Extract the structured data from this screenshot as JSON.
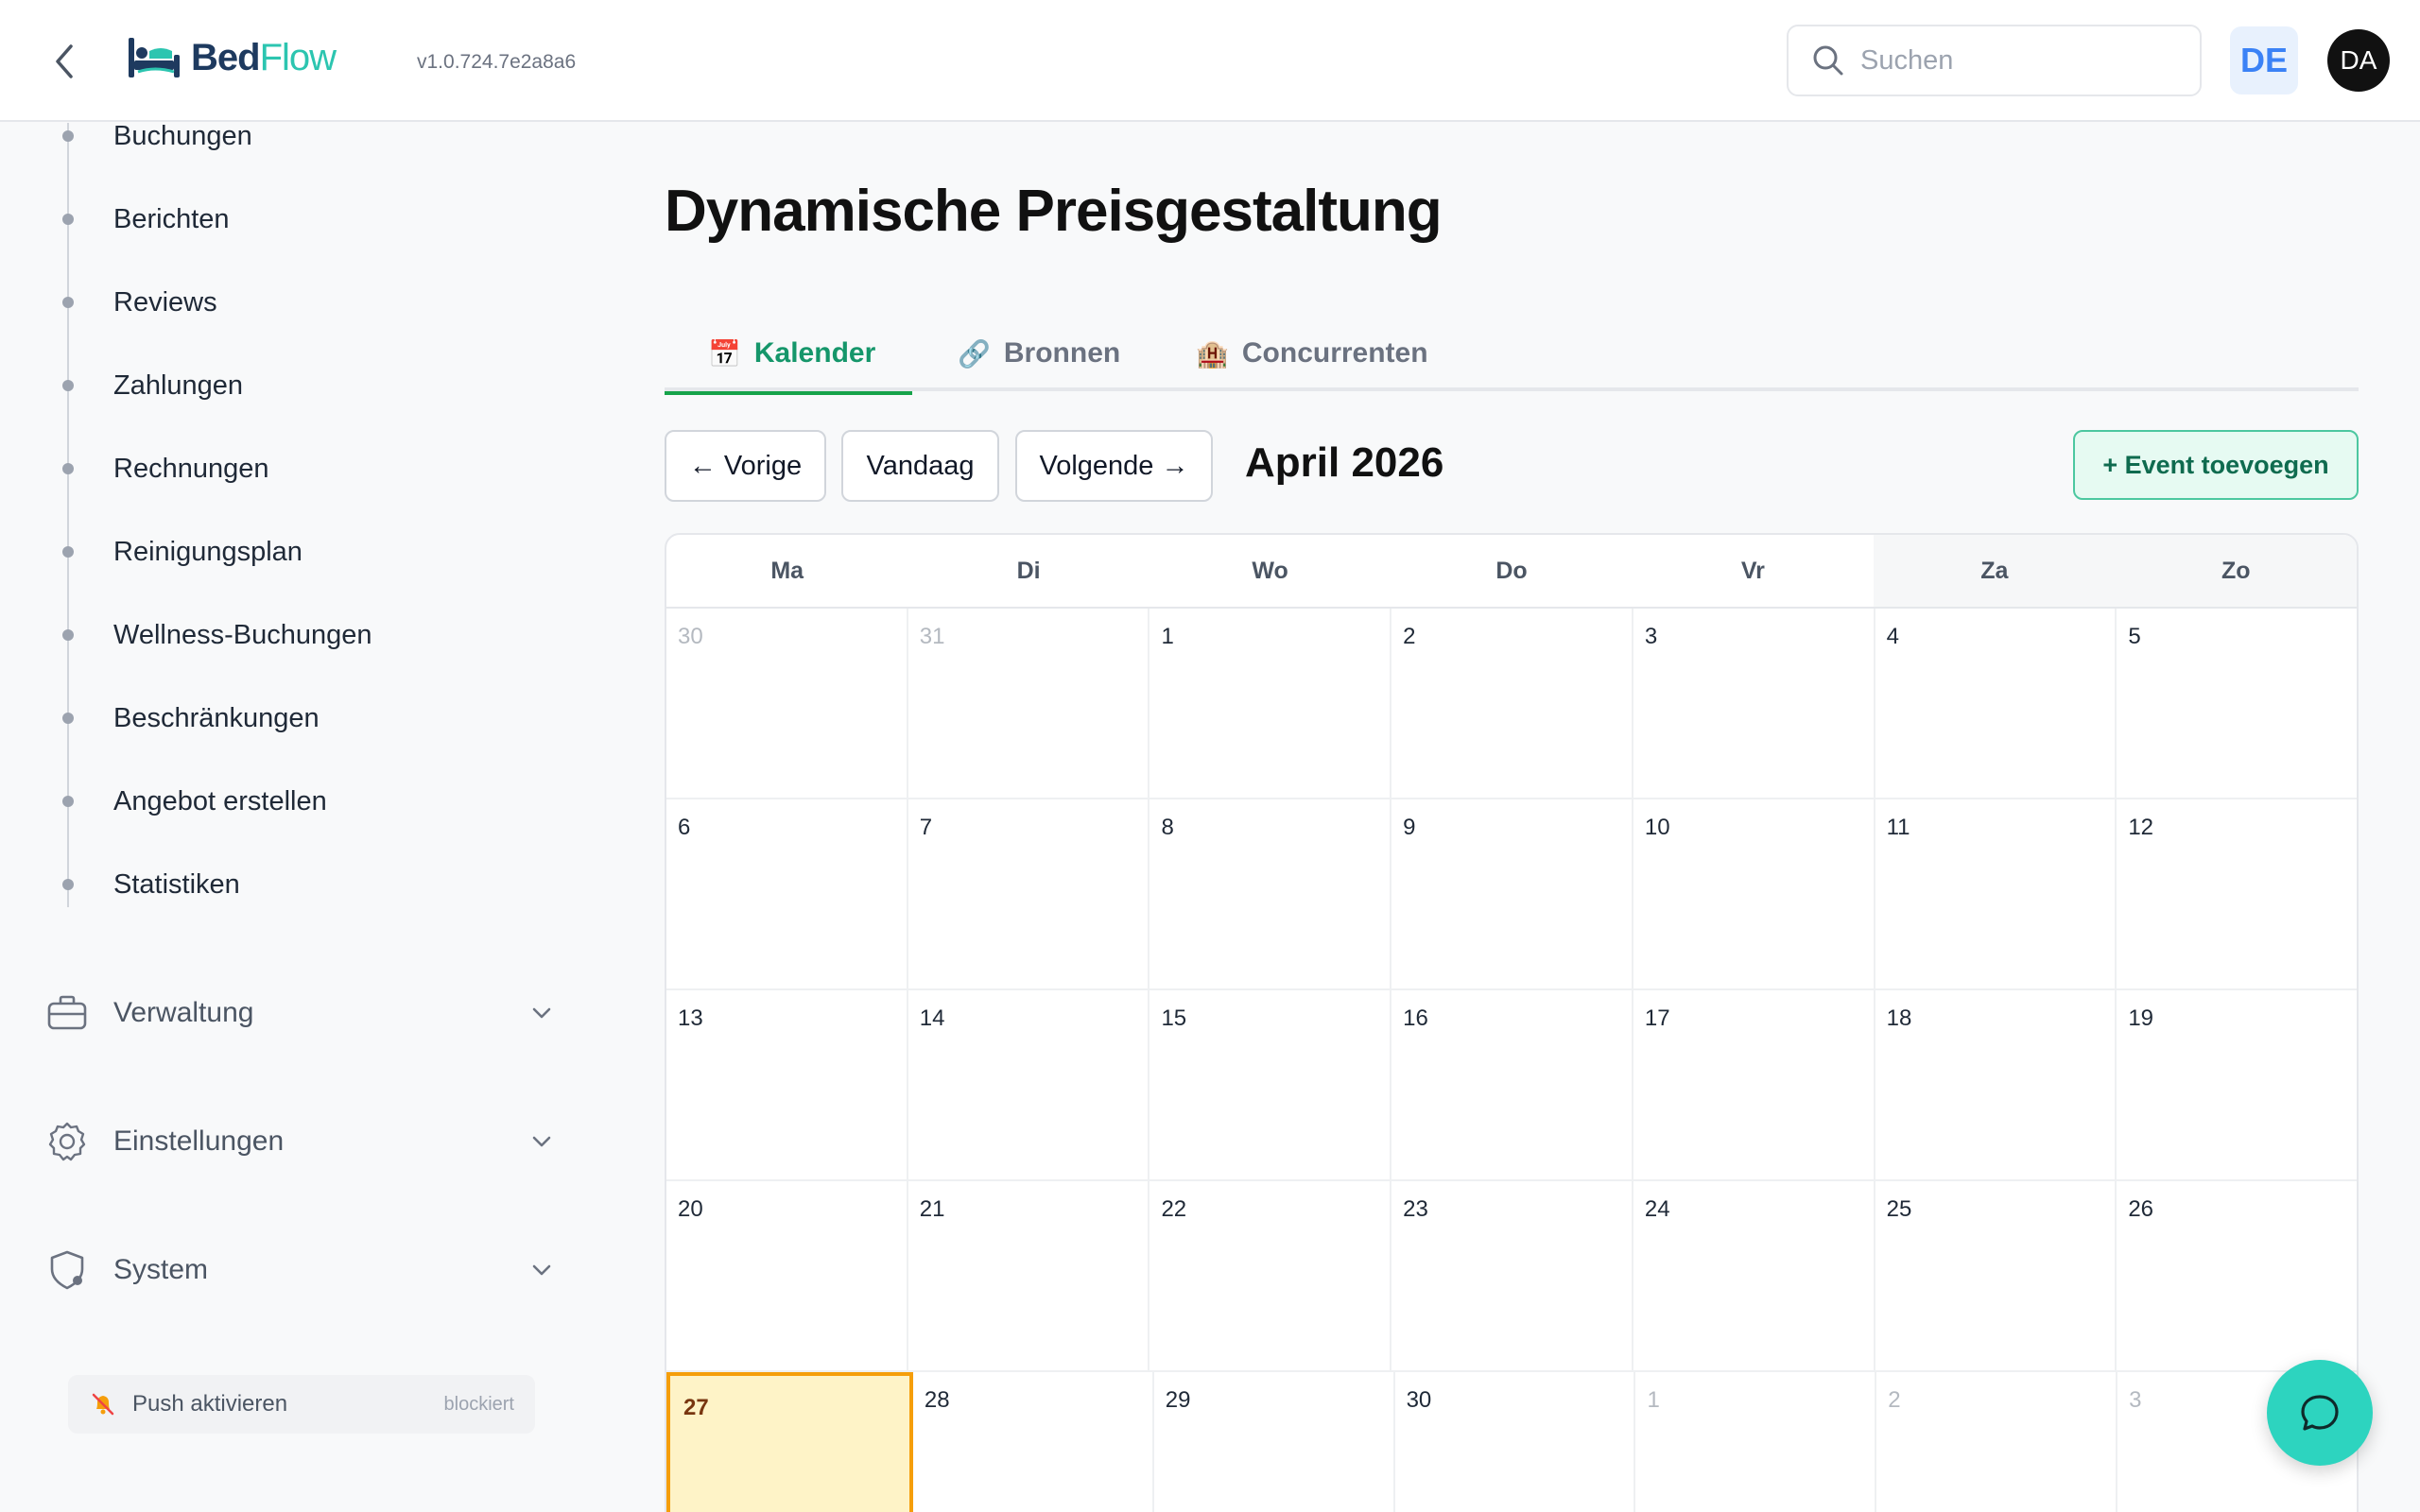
{
  "header": {
    "logo_bed": "Bed",
    "logo_flow": "Flow",
    "version": "v1.0.724.7e2a8a6",
    "search_placeholder": "Suchen",
    "language": "DE",
    "avatar_initials": "DA"
  },
  "sidebar": {
    "sub_items": [
      {
        "label": "Buchungen"
      },
      {
        "label": "Berichten"
      },
      {
        "label": "Reviews"
      },
      {
        "label": "Zahlungen"
      },
      {
        "label": "Rechnungen"
      },
      {
        "label": "Reinigungsplan"
      },
      {
        "label": "Wellness-Buchungen"
      },
      {
        "label": "Beschränkungen"
      },
      {
        "label": "Angebot erstellen"
      },
      {
        "label": "Statistiken"
      }
    ],
    "groups": [
      {
        "label": "Verwaltung",
        "icon": "briefcase-icon"
      },
      {
        "label": "Einstellungen",
        "icon": "gear-icon"
      },
      {
        "label": "System",
        "icon": "shield-icon"
      }
    ],
    "push": {
      "label": "Push aktivieren",
      "status": "blockiert",
      "icon": "bell-off-icon"
    }
  },
  "main": {
    "title": "Dynamische Preisgestaltung",
    "tabs": [
      {
        "icon": "📅",
        "label": "Kalender",
        "active": true
      },
      {
        "icon": "🔗",
        "label": "Bronnen",
        "active": false
      },
      {
        "icon": "🏨",
        "label": "Concurrenten",
        "active": false
      }
    ],
    "nav": {
      "prev": "← Vorige",
      "today": "Vandaag",
      "next": "Volgende →",
      "month": "April 2026",
      "add_event": "+ Event toevoegen"
    },
    "calendar": {
      "weekdays": [
        "Ma",
        "Di",
        "Wo",
        "Do",
        "Vr",
        "Za",
        "Zo"
      ],
      "weeks": [
        [
          {
            "d": "30",
            "other": true
          },
          {
            "d": "31",
            "other": true
          },
          {
            "d": "1"
          },
          {
            "d": "2"
          },
          {
            "d": "3"
          },
          {
            "d": "4"
          },
          {
            "d": "5"
          }
        ],
        [
          {
            "d": "6"
          },
          {
            "d": "7"
          },
          {
            "d": "8"
          },
          {
            "d": "9"
          },
          {
            "d": "10"
          },
          {
            "d": "11"
          },
          {
            "d": "12"
          }
        ],
        [
          {
            "d": "13"
          },
          {
            "d": "14"
          },
          {
            "d": "15"
          },
          {
            "d": "16"
          },
          {
            "d": "17"
          },
          {
            "d": "18"
          },
          {
            "d": "19"
          }
        ],
        [
          {
            "d": "20"
          },
          {
            "d": "21"
          },
          {
            "d": "22"
          },
          {
            "d": "23"
          },
          {
            "d": "24"
          },
          {
            "d": "25"
          },
          {
            "d": "26"
          }
        ],
        [
          {
            "d": "27",
            "today": true
          },
          {
            "d": "28"
          },
          {
            "d": "29"
          },
          {
            "d": "30"
          },
          {
            "d": "1",
            "other": true
          },
          {
            "d": "2",
            "other": true
          },
          {
            "d": "3",
            "other": true
          }
        ]
      ]
    }
  },
  "colors": {
    "accent_green": "#16a34a",
    "today_bg": "#fef3c7",
    "today_border": "#f59e0b",
    "chat_button": "#2dd4bf",
    "lang_badge": "#3b82f6"
  }
}
